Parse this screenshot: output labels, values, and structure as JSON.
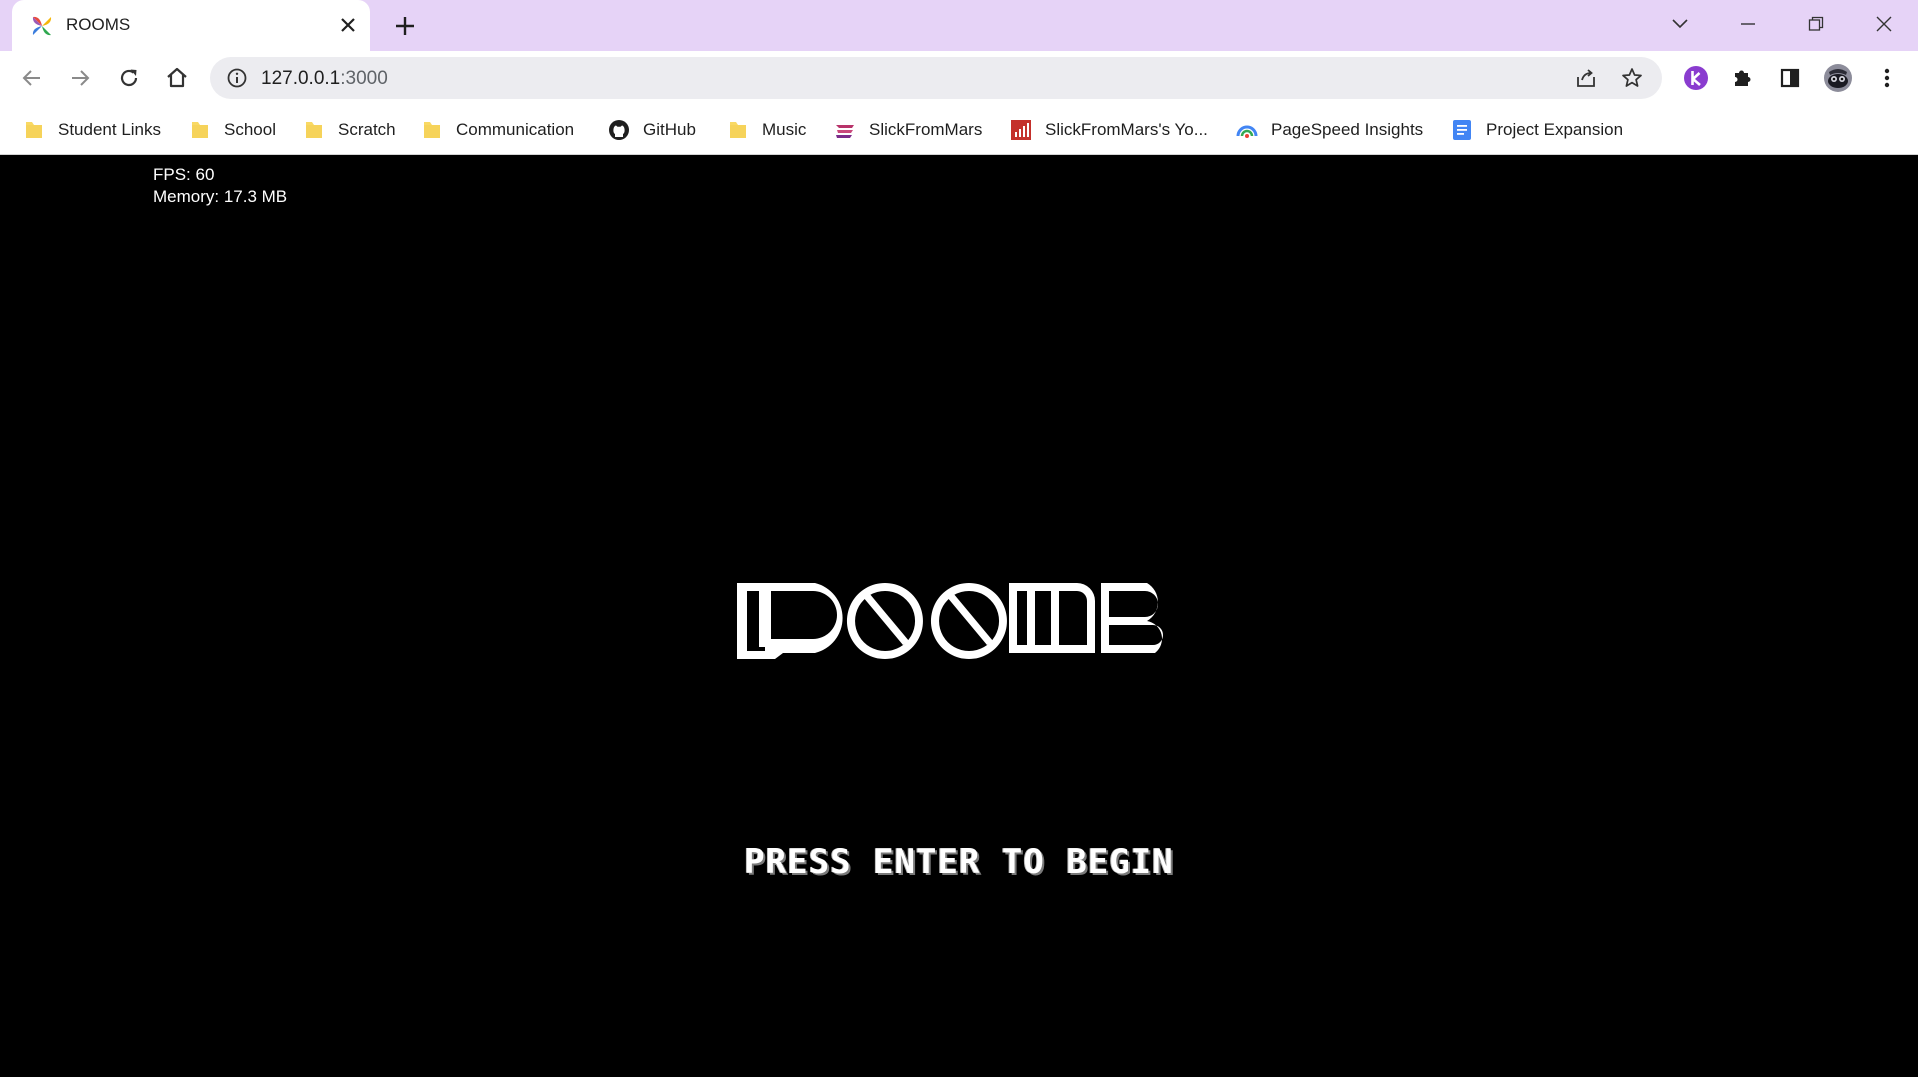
{
  "browser": {
    "tab": {
      "title": "ROOMS",
      "favicon": "rooms-favicon-icon"
    },
    "address_bar": {
      "host": "127.0.0.1",
      "port": ":3000"
    },
    "bookmarks": [
      {
        "label": "Student Links",
        "icon": "folder-icon"
      },
      {
        "label": "School",
        "icon": "folder-icon"
      },
      {
        "label": "Scratch",
        "icon": "folder-icon"
      },
      {
        "label": "Communication",
        "icon": "folder-icon"
      },
      {
        "label": "GitHub",
        "icon": "github-icon"
      },
      {
        "label": "Music",
        "icon": "folder-icon"
      },
      {
        "label": "SlickFromMars",
        "icon": "slickfrommars-icon"
      },
      {
        "label": "SlickFromMars's Yo...",
        "icon": "analytics-icon"
      },
      {
        "label": "PageSpeed Insights",
        "icon": "pagespeed-icon"
      },
      {
        "label": "Project Expansion",
        "icon": "docs-icon"
      }
    ],
    "colors": {
      "tabstrip": "#e6d3f7",
      "folder": "#f9d964",
      "profile_k": "#8a3ccf"
    }
  },
  "game": {
    "stats": {
      "fps": "FPS: 60",
      "memory": "Memory: 17.3 MB"
    },
    "logo_text": "ROOMS",
    "prompt": "PRESS ENTER TO BEGIN"
  }
}
